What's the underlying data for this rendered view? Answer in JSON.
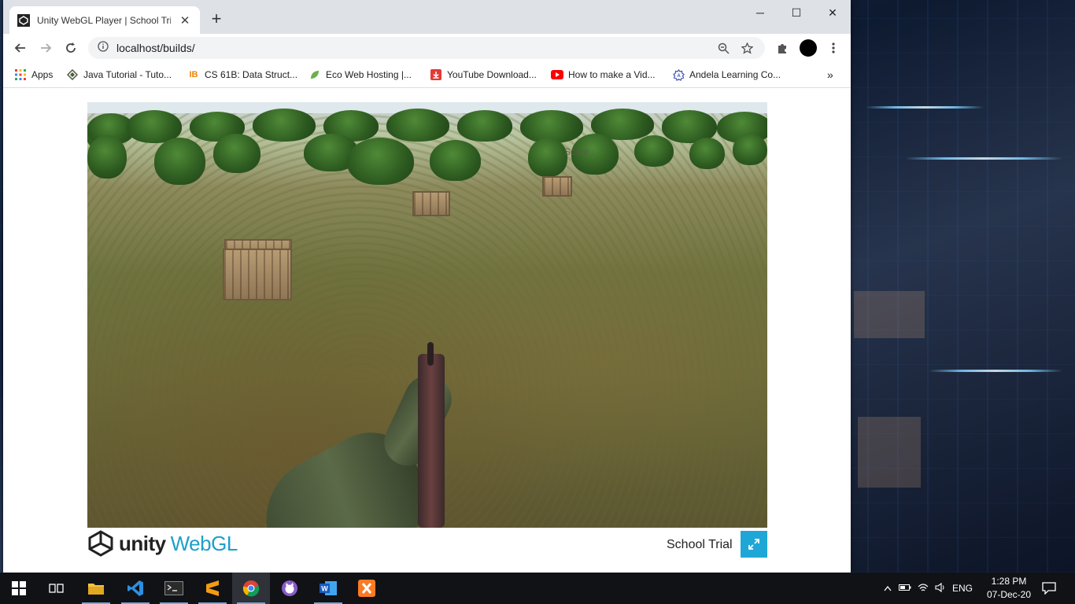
{
  "tab": {
    "title": "Unity WebGL Player | School Trial",
    "close": "✕",
    "new_tab": "+"
  },
  "window_controls": {
    "minimize": "─",
    "maximize": "☐",
    "close": "✕"
  },
  "address_bar": {
    "url": "localhost/builds/"
  },
  "bookmarks": [
    {
      "label": "Apps",
      "icon": "apps-grid-icon"
    },
    {
      "label": "Java Tutorial - Tuto...",
      "icon": "java-tutorial-icon"
    },
    {
      "label": "CS 61B: Data Struct...",
      "icon": "cs61b-icon"
    },
    {
      "label": "Eco Web Hosting |...",
      "icon": "eco-hosting-icon"
    },
    {
      "label": "YouTube Download...",
      "icon": "download-icon"
    },
    {
      "label": "How to make a Vid...",
      "icon": "youtube-icon"
    },
    {
      "label": "Andela Learning Co...",
      "icon": "andela-icon"
    }
  ],
  "bookmarks_overflow": "»",
  "game": {
    "score_label": "Score :"
  },
  "footer": {
    "brand_unity": "unity",
    "brand_webgl": "WebGL",
    "title": "School Trial"
  },
  "taskbar": {
    "apps": [
      "start-icon",
      "task-view-icon",
      "file-explorer-icon",
      "vscode-icon",
      "terminal-icon",
      "sublime-icon",
      "chrome-icon",
      "github-desktop-icon",
      "word-icon",
      "xampp-icon"
    ],
    "language": "ENG",
    "time": "1:28 PM",
    "date": "07-Dec-20"
  },
  "colors": {
    "accent": "#1ea7d6",
    "taskbar": "#101216",
    "tabstrip": "#dee1e6"
  }
}
